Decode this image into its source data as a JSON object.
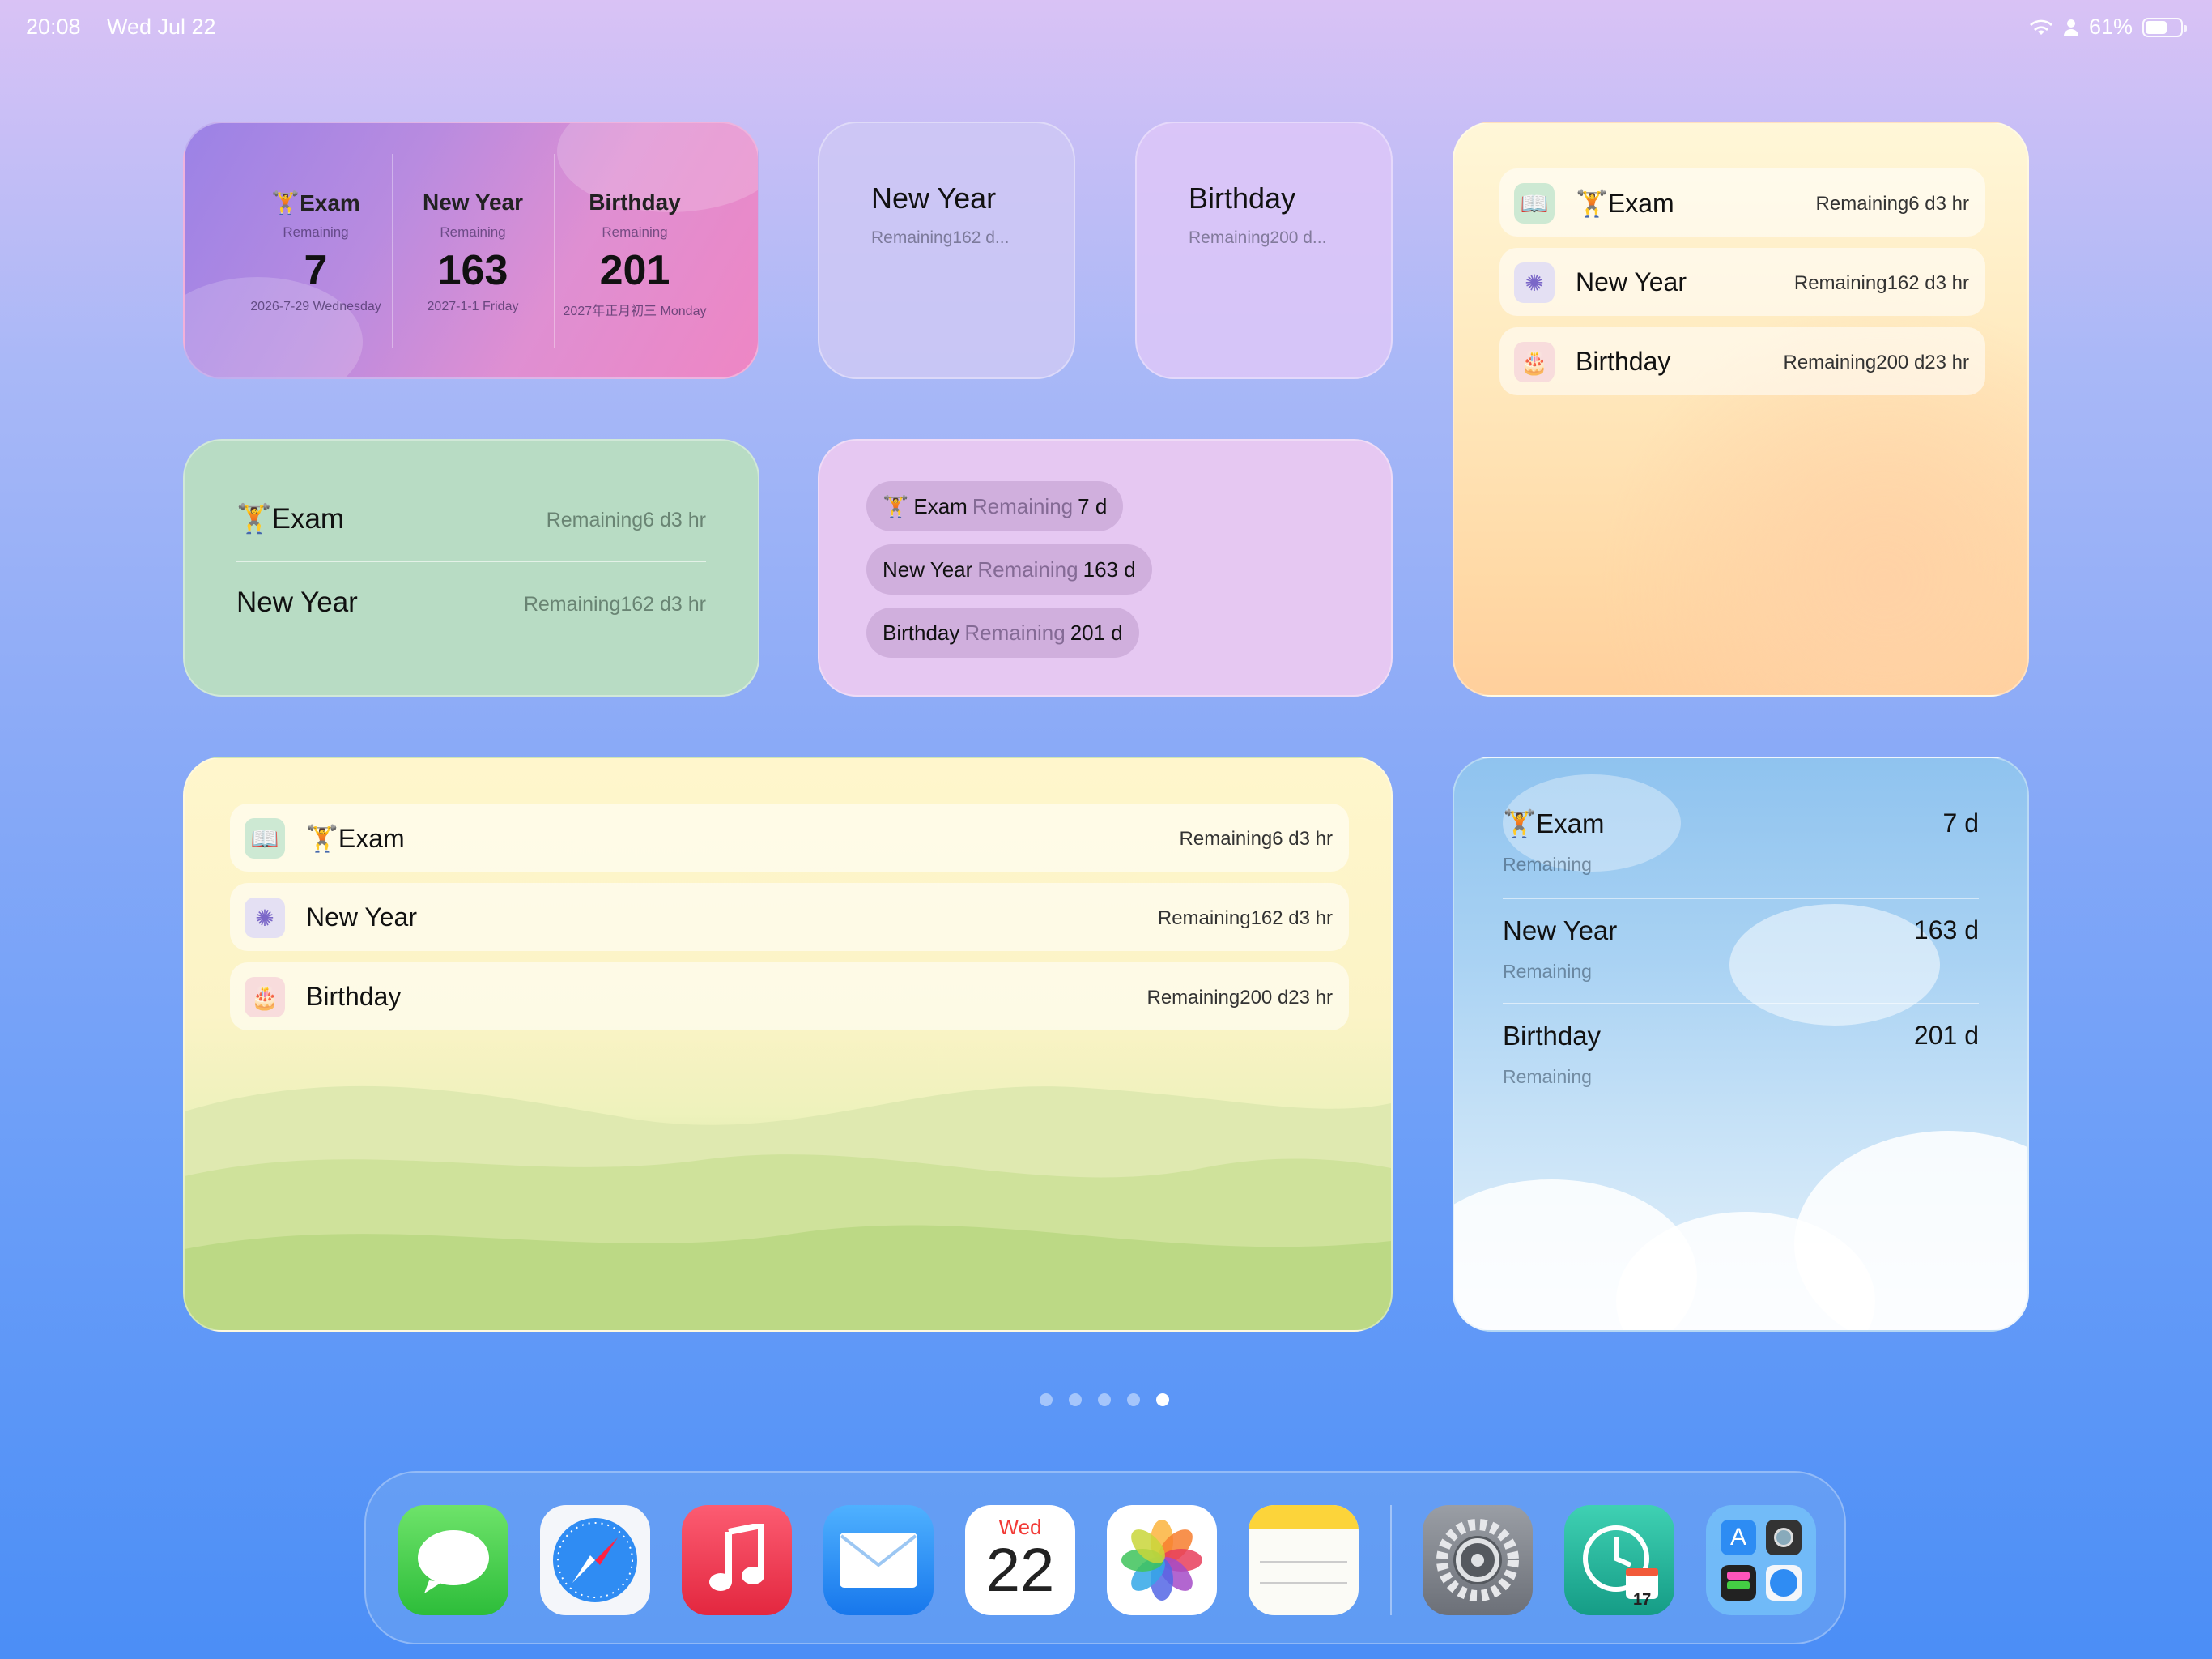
{
  "status_bar": {
    "time": "20:08",
    "date": "Wed Jul 22",
    "battery": "61%",
    "battery_level": 0.61
  },
  "widget_overview": {
    "columns": [
      {
        "title": "Exam",
        "remaining": "Remaining",
        "number": "7",
        "date": "2026-7-29 Wednesday",
        "has_icon": true
      },
      {
        "title": "New Year",
        "remaining": "Remaining",
        "number": "163",
        "date": "2027-1-1 Friday"
      },
      {
        "title": "Birthday",
        "remaining": "Remaining",
        "number": "201",
        "date": "2027年正月初三 Monday"
      }
    ]
  },
  "widget_newyear_small": {
    "title": "New Year",
    "subtitle": "Remaining162 d..."
  },
  "widget_birthday_small": {
    "title": "Birthday",
    "subtitle": "Remaining200 d..."
  },
  "widget_list_orange": {
    "rows": [
      {
        "title": "Exam",
        "value": "Remaining6 d3 hr",
        "icon": "book-icon"
      },
      {
        "title": "New Year",
        "value": "Remaining162 d3 hr",
        "icon": "fireworks-icon"
      },
      {
        "title": "Birthday",
        "value": "Remaining200 d23 hr",
        "icon": "cake-icon"
      }
    ]
  },
  "widget_green": {
    "rows": [
      {
        "title": "Exam",
        "value": "Remaining6 d3 hr"
      },
      {
        "title": "New Year",
        "value": "Remaining162 d3 hr"
      }
    ]
  },
  "widget_pills": {
    "pills": [
      {
        "name": "Exam",
        "remaining": "Remaining",
        "number": "7 d"
      },
      {
        "name": "New Year",
        "remaining": "Remaining",
        "number": "163 d"
      },
      {
        "name": "Birthday",
        "remaining": "Remaining",
        "number": "201 d"
      }
    ]
  },
  "widget_meadow": {
    "rows": [
      {
        "title": "Exam",
        "value": "Remaining6 d3 hr",
        "icon": "book-icon"
      },
      {
        "title": "New Year",
        "value": "Remaining162 d3 hr",
        "icon": "fireworks-icon"
      },
      {
        "title": "Birthday",
        "value": "Remaining200 d23 hr",
        "icon": "cake-icon"
      }
    ]
  },
  "widget_sky": {
    "rows": [
      {
        "title": "Exam",
        "remaining": "Remaining",
        "number": "7 d"
      },
      {
        "title": "New Year",
        "remaining": "Remaining",
        "number": "163 d"
      },
      {
        "title": "Birthday",
        "remaining": "Remaining",
        "number": "201 d"
      }
    ]
  },
  "page_dots": {
    "count": 5,
    "active_index": 4
  },
  "dock": {
    "apps": [
      "messages-app-icon",
      "safari-app-icon",
      "music-app-icon",
      "mail-app-icon",
      "calendar-app-icon",
      "photos-app-icon",
      "notes-app-icon",
      "settings-app-icon",
      "countdown-app-icon",
      "app-folder-icon"
    ],
    "calendar_day": "Wed",
    "calendar_date": "22",
    "countdown_badge": "17"
  },
  "colors": {
    "accent_blue": "#4b8ef6",
    "pill_bg": "#e6c8f2",
    "green_widget": "#b8dcc4"
  }
}
